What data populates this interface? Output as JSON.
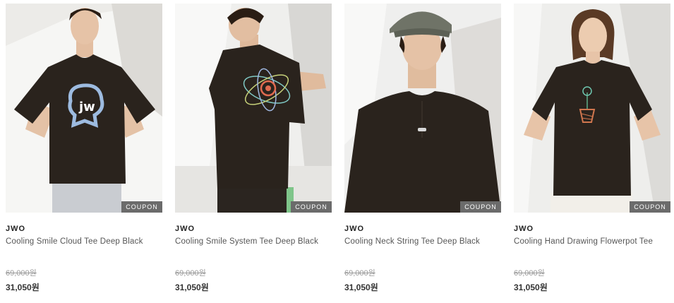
{
  "products": [
    {
      "brand": "JWO",
      "name": "Cooling Smile Cloud Tee Deep Black",
      "original_price": "69,000원",
      "sale_price": "31,050원",
      "coupon": "COUPON"
    },
    {
      "brand": "JWO",
      "name": "Cooling Smile System Tee Deep Black",
      "original_price": "69,000원",
      "sale_price": "31,050원",
      "coupon": "COUPON"
    },
    {
      "brand": "JWO",
      "name": "Cooling Neck String Tee Deep Black",
      "original_price": "69,000원",
      "sale_price": "31,050원",
      "coupon": "COUPON"
    },
    {
      "brand": "JWO",
      "name": "Cooling Hand Drawing Flowerpot Tee",
      "original_price": "69,000원",
      "sale_price": "31,050원",
      "coupon": "COUPON"
    }
  ],
  "colors": {
    "coupon_bg": "#6b6b6b",
    "original_price": "#999999",
    "sale_price": "#333333",
    "tee": "#2a231d"
  }
}
